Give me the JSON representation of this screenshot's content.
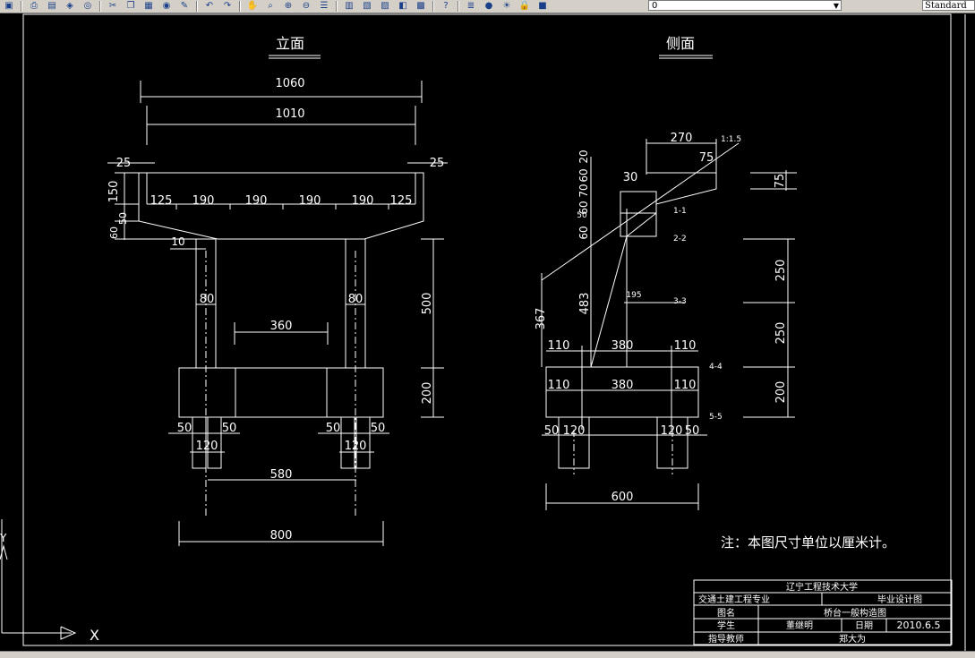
{
  "toolbar": {
    "icons": [
      "save-icon",
      "print-icon",
      "preview-icon",
      "publish-icon",
      "plot-icon",
      "cut-icon",
      "copy-icon",
      "paste-icon",
      "match-icon",
      "brush-icon",
      "undo-icon",
      "redo-icon",
      "pan-icon",
      "zoom-realtime-icon",
      "zoom-window-icon",
      "zoom-previous-icon",
      "properties-icon",
      "design-center-icon",
      "tool-palette-icon",
      "sheet-set-icon",
      "markup-icon",
      "calculator-icon",
      "help-icon",
      "layer-manager-icon",
      "bulb-icon",
      "sun-icon",
      "lock-icon",
      "color-square-icon"
    ],
    "layer_value": "0",
    "text_style_value": "Standard"
  },
  "drawing": {
    "front_title": "立面",
    "side_title": "侧面",
    "front_dims": {
      "overall": "1060",
      "inner": "1010",
      "left_offset": "25",
      "right_offset": "25",
      "cap_height": "150",
      "cap_sub_a": "50",
      "cap_sub_b": "60",
      "spans": [
        "125",
        "190",
        "190",
        "190",
        "190",
        "125"
      ],
      "taper": "10",
      "col_w_left": "80",
      "col_w_right": "80",
      "col_gap": "360",
      "col_height": "500",
      "footing_height": "200",
      "pile_edge_l1": "50",
      "pile_edge_l2": "50",
      "pile_edge_r1": "50",
      "pile_edge_r2": "50",
      "pile_dia_left": "120",
      "pile_dia_right": "120",
      "pile_spacing": "580",
      "footing_width": "800"
    },
    "side_dims": {
      "top_width": "270",
      "slope": "1:1.5",
      "wing_top": "75",
      "wing_right": "75",
      "ledge": "30",
      "top_stack": "20",
      "stack_b": "60",
      "stack_c": "70",
      "stack_d": "60",
      "stack_e": "50",
      "stack_f": "60",
      "sec_11": "1-1",
      "sec_22": "2-2",
      "sec_33": "3-3",
      "sec_44": "4-4",
      "sec_55": "5-5",
      "span_195": "195",
      "h_250a": "250",
      "h_250b": "250",
      "h_200": "200",
      "h_367": "367",
      "h_483": "483",
      "row1": [
        "110",
        "380",
        "110"
      ],
      "row2": [
        "110",
        "380",
        "110"
      ],
      "pile_edge_l": "50",
      "pile_dia_l": "120",
      "pile_dia_r": "120",
      "pile_edge_r": "50",
      "total_width": "600"
    },
    "note": "注：本图尺寸单位以厘米计。",
    "ucs_x": "X",
    "ucs_y": "Y",
    "title_block": {
      "university": "辽宁工程技术大学",
      "major": "交通土建工程专业",
      "design_type": "毕业设计图",
      "drawing_name_label": "图名",
      "drawing_name": "桥台一般构造图",
      "student_label": "学生",
      "student": "董继明",
      "date_label": "日期",
      "date": "2010.6.5",
      "advisor_label": "指导教师",
      "advisor": "郑大为"
    }
  }
}
